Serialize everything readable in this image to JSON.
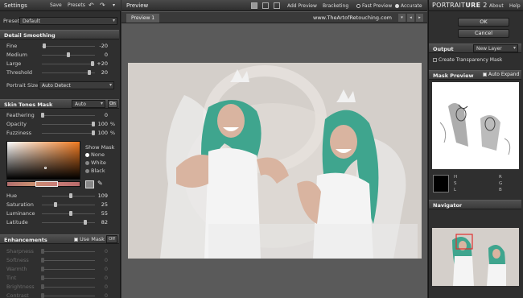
{
  "left_panel": {
    "header": {
      "title": "Settings",
      "save": "Save",
      "presets": "Presets"
    },
    "preset": {
      "label": "Preset",
      "value": "Default"
    },
    "detail": {
      "title": "Detail Smoothing",
      "sliders": [
        {
          "label": "Fine",
          "value": "-20",
          "pos": 0.05
        },
        {
          "label": "Medium",
          "value": "0",
          "pos": 0.5
        },
        {
          "label": "Large",
          "value": "+20",
          "pos": 0.95
        },
        {
          "label": "Threshold",
          "value": "20",
          "pos": 0.9
        }
      ],
      "portrait_size_label": "Portrait Size",
      "portrait_size_value": "Auto Detect"
    },
    "skin": {
      "title": "Skin Tones Mask",
      "mode": "Auto",
      "on": "On",
      "sliders": [
        {
          "label": "Feathering",
          "value": "0",
          "unit": "",
          "pos": 0.02
        },
        {
          "label": "Opacity",
          "value": "100",
          "unit": "%",
          "pos": 0.97
        },
        {
          "label": "Fuzziness",
          "value": "100",
          "unit": "%",
          "pos": 0.97
        }
      ],
      "show_mask_label": "Show Mask",
      "show_mask_options": [
        "None",
        "White",
        "Black"
      ],
      "hsl": [
        {
          "label": "Hue",
          "value": "109",
          "pos": 0.55
        },
        {
          "label": "Saturation",
          "value": "25",
          "pos": 0.25
        },
        {
          "label": "Luminance",
          "value": "55",
          "pos": 0.55
        },
        {
          "label": "Latitude",
          "value": "82",
          "pos": 0.82
        }
      ]
    },
    "enh": {
      "title": "Enhancements",
      "use_mask": "Use Mask",
      "off": "Off",
      "sliders": [
        {
          "label": "Sharpness",
          "value": "0"
        },
        {
          "label": "Softness",
          "value": "0"
        },
        {
          "label": "Warmth",
          "value": "0"
        },
        {
          "label": "Tint",
          "value": "0"
        },
        {
          "label": "Brightness",
          "value": "0"
        },
        {
          "label": "Contrast",
          "value": "0"
        }
      ]
    }
  },
  "center": {
    "title": "Preview",
    "add_preview": "Add Preview",
    "bracketing": "Bracketing",
    "fast_preview": "Fast Preview",
    "accurate": "Accurate",
    "tab": "Preview 1",
    "watermark": "www.TheArtofRetouching.com"
  },
  "right_panel": {
    "brand_a": "PORTRAIT",
    "brand_b": "URE",
    "brand_ver": "2",
    "about": "About",
    "help": "Help",
    "ok": "OK",
    "cancel": "Cancel",
    "output_title": "Output",
    "output_value": "New Layer",
    "create_mask": "Create Transparency Mask",
    "mask_preview_title": "Mask Preview",
    "auto_expand": "Auto Expand",
    "readout_left": [
      "H",
      "S",
      "L"
    ],
    "readout_right": [
      "R",
      "G",
      "B"
    ],
    "navigator_title": "Navigator"
  },
  "colors": {
    "accent_mask": "#1a1a1a",
    "nav_box": "#e03030"
  }
}
